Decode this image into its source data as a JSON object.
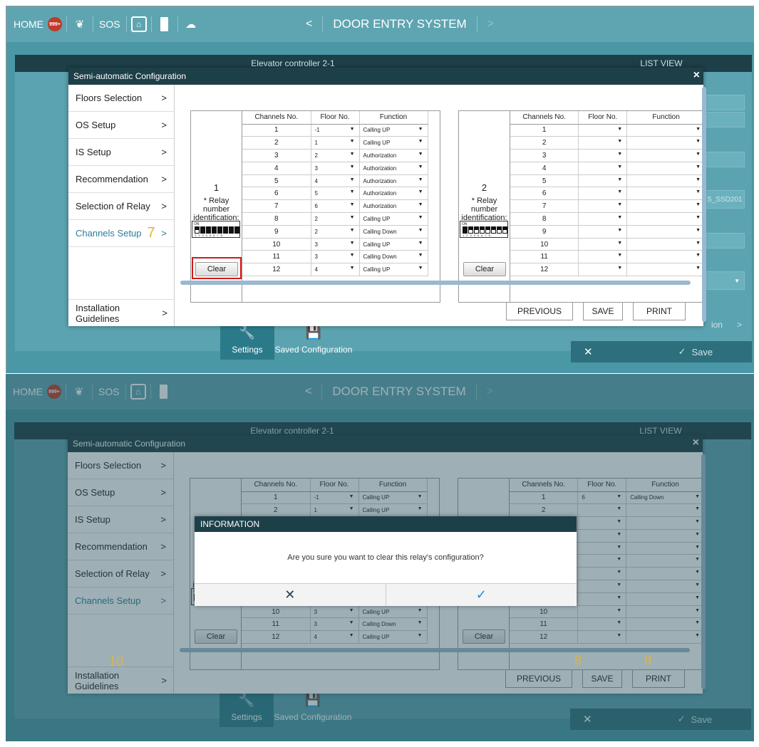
{
  "topbar": {
    "home": "HOME",
    "badge": "999+",
    "sos": "SOS",
    "title": "DOOR ENTRY SYSTEM",
    "icons": [
      "notification-badge",
      "chat-icon",
      "sos",
      "home-icon",
      "door-icon",
      "cloud-upload-icon"
    ]
  },
  "background": {
    "center_header": "Elevator controller 2-1",
    "right_header": "LIST VIEW",
    "right_value": "S_SSD201",
    "guidelines_suffix": "ion",
    "bottom_settings": "Settings",
    "bottom_saved": "Saved Configuration",
    "right_save": "Save",
    "right_cancel": "✕",
    "right_check": "✓"
  },
  "modal": {
    "title": "Semi-automatic Configuration",
    "close": "×",
    "sidebar": [
      {
        "label": "Floors Selection"
      },
      {
        "label": "OS Setup"
      },
      {
        "label": "IS Setup"
      },
      {
        "label": "Recommendation"
      },
      {
        "label": "Selection of Relay"
      },
      {
        "label": "Channels Setup"
      }
    ],
    "sidebar_bottom": "Installation Guidelines",
    "chevron": ">",
    "buttons": {
      "previous": "PREVIOUS",
      "save": "SAVE",
      "print": "PRINT"
    },
    "relay_label": "* Relay number identification:",
    "clear_label": "Clear",
    "dip_on": "ON",
    "dip_nums": "12345678",
    "columns": [
      "Channels No.",
      "Floor No.",
      "Function"
    ],
    "relay1": {
      "number": "1",
      "rows": [
        {
          "ch": "1",
          "floor": "-1",
          "func": "Calling UP"
        },
        {
          "ch": "2",
          "floor": "1",
          "func": "Calling UP"
        },
        {
          "ch": "3",
          "floor": "2",
          "func": "Authorization"
        },
        {
          "ch": "4",
          "floor": "3",
          "func": "Authorization"
        },
        {
          "ch": "5",
          "floor": "4",
          "func": "Authorization"
        },
        {
          "ch": "6",
          "floor": "5",
          "func": "Authorization"
        },
        {
          "ch": "7",
          "floor": "6",
          "func": "Authorization"
        },
        {
          "ch": "8",
          "floor": "2",
          "func": "Calling UP"
        },
        {
          "ch": "9",
          "floor": "2",
          "func": "Calling Down"
        },
        {
          "ch": "10",
          "floor": "3",
          "func": "Calling UP"
        },
        {
          "ch": "11",
          "floor": "3",
          "func": "Calling Down"
        },
        {
          "ch": "12",
          "floor": "4",
          "func": "Calling UP"
        }
      ]
    },
    "relay2": {
      "number": "2",
      "rows": [
        {
          "ch": "1",
          "floor": "",
          "func": ""
        },
        {
          "ch": "2",
          "floor": "",
          "func": ""
        },
        {
          "ch": "3",
          "floor": "",
          "func": ""
        },
        {
          "ch": "4",
          "floor": "",
          "func": ""
        },
        {
          "ch": "5",
          "floor": "",
          "func": ""
        },
        {
          "ch": "6",
          "floor": "",
          "func": ""
        },
        {
          "ch": "7",
          "floor": "",
          "func": ""
        },
        {
          "ch": "8",
          "floor": "",
          "func": ""
        },
        {
          "ch": "9",
          "floor": "",
          "func": ""
        },
        {
          "ch": "10",
          "floor": "",
          "func": ""
        },
        {
          "ch": "11",
          "floor": "",
          "func": ""
        },
        {
          "ch": "12",
          "floor": "",
          "func": ""
        }
      ]
    },
    "relay2_second": {
      "first_row_floor": "6",
      "first_row_func": "Calling Down"
    }
  },
  "info_dialog": {
    "title": "INFORMATION",
    "message": "Are you sure you want to clear this relay's configuration?",
    "cancel": "✕",
    "confirm": "✓"
  },
  "annotations": {
    "channels_setup": "7",
    "save": "8",
    "print": "9",
    "guidelines": "10"
  }
}
